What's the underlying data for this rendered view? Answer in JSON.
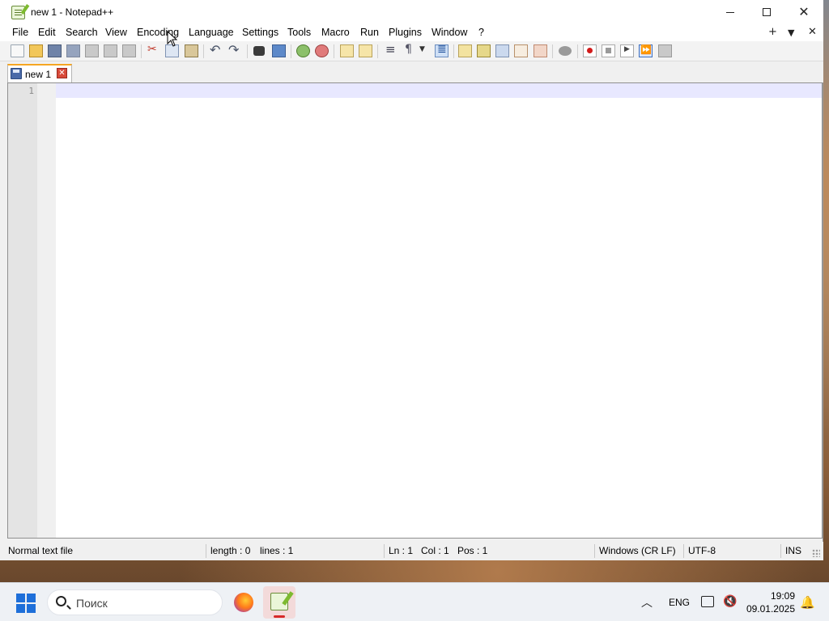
{
  "window": {
    "title": "new 1 - Notepad++",
    "controls": {
      "minimize": "—",
      "maximize": "□",
      "close": "✕"
    }
  },
  "menu": {
    "items": [
      "File",
      "Edit",
      "Search",
      "View",
      "Encoding",
      "Language",
      "Settings",
      "Tools",
      "Macro",
      "Run",
      "Plugins",
      "Window",
      "?"
    ],
    "right": {
      "add": "+",
      "dropdown": "▼",
      "close": "✕"
    }
  },
  "toolbar": {
    "icons": [
      "new-file-icon",
      "open-file-icon",
      "save-icon",
      "save-all-icon",
      "close-icon",
      "close-all-icon",
      "print-icon",
      "cut-icon",
      "copy-icon",
      "paste-icon",
      "undo-icon",
      "redo-icon",
      "find-icon",
      "replace-icon",
      "zoom-in-icon",
      "zoom-out-icon",
      "sync-vertical-icon",
      "sync-horizontal-icon",
      "word-wrap-icon",
      "show-all-chars-icon",
      "indent-guide-icon",
      "language-icon",
      "document-map-icon",
      "function-list-icon",
      "folder-as-workspace-icon",
      "monitoring-icon",
      "record-macro-icon",
      "stop-macro-icon",
      "play-macro-icon",
      "run-macro-multiple-icon",
      "save-macro-icon"
    ]
  },
  "tabs": [
    {
      "label": "new 1",
      "close": "✕"
    }
  ],
  "editor": {
    "line_numbers": [
      "1"
    ],
    "content": ""
  },
  "status": {
    "file_type": "Normal text file",
    "length": "length : 0",
    "lines": "lines : 1",
    "ln": "Ln : 1",
    "col": "Col : 1",
    "pos": "Pos : 1",
    "eol": "Windows (CR LF)",
    "encoding": "UTF-8",
    "mode": "INS"
  },
  "taskbar": {
    "search_placeholder": "Поиск",
    "language": "ENG",
    "time": "19:09",
    "date": "09.01.2025"
  }
}
